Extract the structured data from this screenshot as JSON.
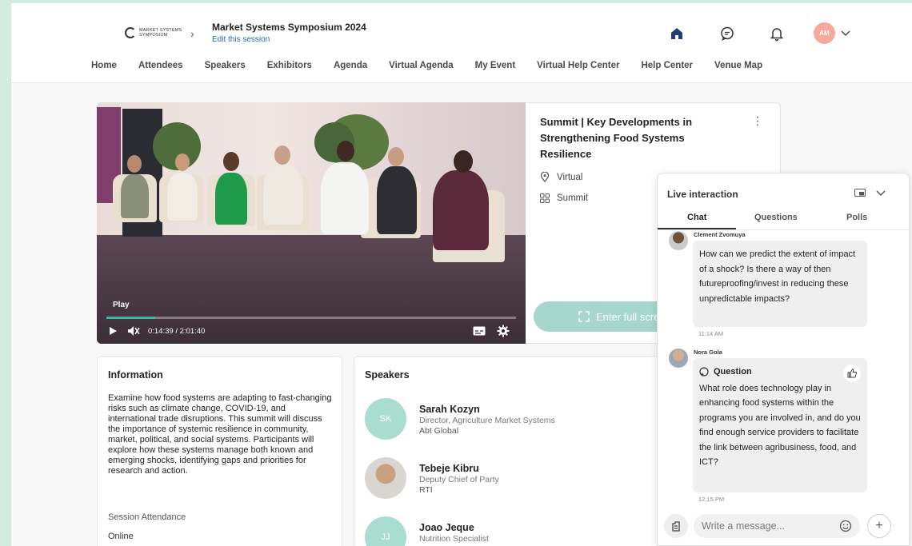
{
  "header": {
    "logo_text": "MARKET SYSTEMS SYMPOSIUM",
    "event_title": "Market Systems Symposium 2024",
    "edit_link": "Edit this session",
    "avatar_initials": "AM",
    "icons": [
      "home-icon",
      "chat-bubble-icon",
      "bell-icon",
      "chevron-down-icon"
    ],
    "avatar_color": "#f6a99d"
  },
  "nav": {
    "items": [
      {
        "label": "Home"
      },
      {
        "label": "Attendees"
      },
      {
        "label": "Speakers"
      },
      {
        "label": "Exhibitors"
      },
      {
        "label": "Agenda"
      },
      {
        "label": "Virtual Agenda"
      },
      {
        "label": "My Event"
      },
      {
        "label": "Virtual Help Center"
      },
      {
        "label": "Help Center"
      },
      {
        "label": "Venue Map"
      }
    ]
  },
  "video": {
    "play_label": "Play",
    "current_time": "0:14:39",
    "duration": "2:01:40",
    "time_separator": "/",
    "progress_fraction": 0.12,
    "accent": "#3db8a0"
  },
  "session": {
    "title": "Summit | Key Developments in Strengthening Food Systems Resilience",
    "location": "Virtual",
    "type": "Summit",
    "fullscreen_label": "Enter full scre",
    "button_color": "#a6d7cc"
  },
  "information": {
    "heading": "Information",
    "description": "Examine how food systems are adapting to fast-changing risks such as climate change, COVID-19, and international trade disruptions. This summit will discuss the importance of systemic resilience in community, market, political, and social systems. Participants will explore how these systems manage both known and emerging shocks, identifying gaps and priorities for research and action.",
    "attendance_label": "Session Attendance",
    "attendance_value": "Online"
  },
  "speakers": {
    "heading": "Speakers",
    "items": [
      {
        "initials": "SK",
        "name": "Sarah Kozyn",
        "role": "Director, Agriculture Market Systems",
        "org": "Abt Global"
      },
      {
        "initials": "",
        "name": "Tebeje Kibru",
        "role": "Deputy Chief of Party",
        "org": "RTI"
      },
      {
        "initials": "JJ",
        "name": "Joao Jeque",
        "role": "Nutrition Specialist",
        "org": ""
      }
    ]
  },
  "live": {
    "title": "Live interaction",
    "tabs": [
      {
        "label": "Chat",
        "active": true
      },
      {
        "label": "Questions",
        "active": false
      },
      {
        "label": "Polls",
        "active": false
      }
    ],
    "messages": [
      {
        "author": "Clement Zvomuya",
        "text": "How can we predict the extent of impact of a shock? Is there a way of then futureproofing/invest in reducing these unpredictable impacts?",
        "time": "11:14 AM"
      },
      {
        "author": "Nora Gola",
        "tag": "Question",
        "text": "What role does technology play in enhancing food systems within the programs you are involved in, and do you find enough service providers to facilitate the link between agribusiness, food, and ICT?",
        "time": "12:15 PM"
      }
    ],
    "composer_placeholder": "Write a message..."
  }
}
